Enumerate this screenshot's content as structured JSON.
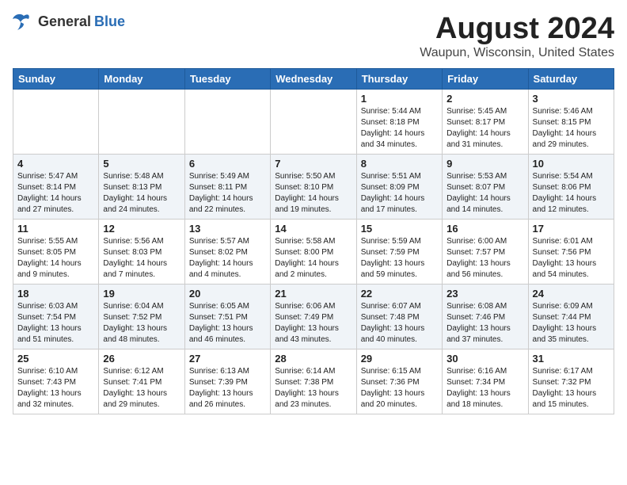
{
  "header": {
    "logo_general": "General",
    "logo_blue": "Blue",
    "month_title": "August 2024",
    "location": "Waupun, Wisconsin, United States"
  },
  "weekdays": [
    "Sunday",
    "Monday",
    "Tuesday",
    "Wednesday",
    "Thursday",
    "Friday",
    "Saturday"
  ],
  "weeks": [
    [
      {
        "day": "",
        "info": ""
      },
      {
        "day": "",
        "info": ""
      },
      {
        "day": "",
        "info": ""
      },
      {
        "day": "",
        "info": ""
      },
      {
        "day": "1",
        "info": "Sunrise: 5:44 AM\nSunset: 8:18 PM\nDaylight: 14 hours\nand 34 minutes."
      },
      {
        "day": "2",
        "info": "Sunrise: 5:45 AM\nSunset: 8:17 PM\nDaylight: 14 hours\nand 31 minutes."
      },
      {
        "day": "3",
        "info": "Sunrise: 5:46 AM\nSunset: 8:15 PM\nDaylight: 14 hours\nand 29 minutes."
      }
    ],
    [
      {
        "day": "4",
        "info": "Sunrise: 5:47 AM\nSunset: 8:14 PM\nDaylight: 14 hours\nand 27 minutes."
      },
      {
        "day": "5",
        "info": "Sunrise: 5:48 AM\nSunset: 8:13 PM\nDaylight: 14 hours\nand 24 minutes."
      },
      {
        "day": "6",
        "info": "Sunrise: 5:49 AM\nSunset: 8:11 PM\nDaylight: 14 hours\nand 22 minutes."
      },
      {
        "day": "7",
        "info": "Sunrise: 5:50 AM\nSunset: 8:10 PM\nDaylight: 14 hours\nand 19 minutes."
      },
      {
        "day": "8",
        "info": "Sunrise: 5:51 AM\nSunset: 8:09 PM\nDaylight: 14 hours\nand 17 minutes."
      },
      {
        "day": "9",
        "info": "Sunrise: 5:53 AM\nSunset: 8:07 PM\nDaylight: 14 hours\nand 14 minutes."
      },
      {
        "day": "10",
        "info": "Sunrise: 5:54 AM\nSunset: 8:06 PM\nDaylight: 14 hours\nand 12 minutes."
      }
    ],
    [
      {
        "day": "11",
        "info": "Sunrise: 5:55 AM\nSunset: 8:05 PM\nDaylight: 14 hours\nand 9 minutes."
      },
      {
        "day": "12",
        "info": "Sunrise: 5:56 AM\nSunset: 8:03 PM\nDaylight: 14 hours\nand 7 minutes."
      },
      {
        "day": "13",
        "info": "Sunrise: 5:57 AM\nSunset: 8:02 PM\nDaylight: 14 hours\nand 4 minutes."
      },
      {
        "day": "14",
        "info": "Sunrise: 5:58 AM\nSunset: 8:00 PM\nDaylight: 14 hours\nand 2 minutes."
      },
      {
        "day": "15",
        "info": "Sunrise: 5:59 AM\nSunset: 7:59 PM\nDaylight: 13 hours\nand 59 minutes."
      },
      {
        "day": "16",
        "info": "Sunrise: 6:00 AM\nSunset: 7:57 PM\nDaylight: 13 hours\nand 56 minutes."
      },
      {
        "day": "17",
        "info": "Sunrise: 6:01 AM\nSunset: 7:56 PM\nDaylight: 13 hours\nand 54 minutes."
      }
    ],
    [
      {
        "day": "18",
        "info": "Sunrise: 6:03 AM\nSunset: 7:54 PM\nDaylight: 13 hours\nand 51 minutes."
      },
      {
        "day": "19",
        "info": "Sunrise: 6:04 AM\nSunset: 7:52 PM\nDaylight: 13 hours\nand 48 minutes."
      },
      {
        "day": "20",
        "info": "Sunrise: 6:05 AM\nSunset: 7:51 PM\nDaylight: 13 hours\nand 46 minutes."
      },
      {
        "day": "21",
        "info": "Sunrise: 6:06 AM\nSunset: 7:49 PM\nDaylight: 13 hours\nand 43 minutes."
      },
      {
        "day": "22",
        "info": "Sunrise: 6:07 AM\nSunset: 7:48 PM\nDaylight: 13 hours\nand 40 minutes."
      },
      {
        "day": "23",
        "info": "Sunrise: 6:08 AM\nSunset: 7:46 PM\nDaylight: 13 hours\nand 37 minutes."
      },
      {
        "day": "24",
        "info": "Sunrise: 6:09 AM\nSunset: 7:44 PM\nDaylight: 13 hours\nand 35 minutes."
      }
    ],
    [
      {
        "day": "25",
        "info": "Sunrise: 6:10 AM\nSunset: 7:43 PM\nDaylight: 13 hours\nand 32 minutes."
      },
      {
        "day": "26",
        "info": "Sunrise: 6:12 AM\nSunset: 7:41 PM\nDaylight: 13 hours\nand 29 minutes."
      },
      {
        "day": "27",
        "info": "Sunrise: 6:13 AM\nSunset: 7:39 PM\nDaylight: 13 hours\nand 26 minutes."
      },
      {
        "day": "28",
        "info": "Sunrise: 6:14 AM\nSunset: 7:38 PM\nDaylight: 13 hours\nand 23 minutes."
      },
      {
        "day": "29",
        "info": "Sunrise: 6:15 AM\nSunset: 7:36 PM\nDaylight: 13 hours\nand 20 minutes."
      },
      {
        "day": "30",
        "info": "Sunrise: 6:16 AM\nSunset: 7:34 PM\nDaylight: 13 hours\nand 18 minutes."
      },
      {
        "day": "31",
        "info": "Sunrise: 6:17 AM\nSunset: 7:32 PM\nDaylight: 13 hours\nand 15 minutes."
      }
    ]
  ]
}
